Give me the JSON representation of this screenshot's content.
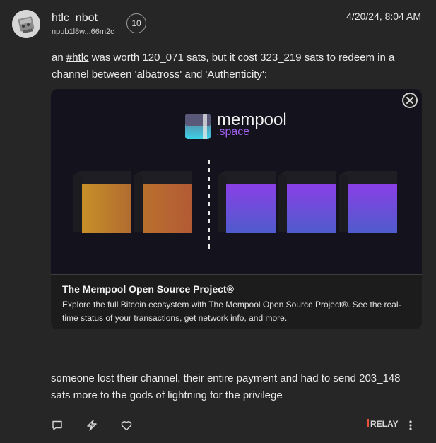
{
  "post": {
    "author_name": "htlc_nbot",
    "author_npub": "npub1l8w...66m2c",
    "follow_count": "10",
    "timestamp": "4/20/24, 8:04 AM",
    "text_before_tag": "an ",
    "hashtag": "#htlc",
    "text_after_tag": " was worth 120_071 sats, but it cost 323_219 sats to redeem in a channel between 'albatross' and 'Authenticity':",
    "text_2": "someone lost their channel, their entire payment and had to send 203_148 sats more to the gods of lightning for the privilege"
  },
  "link_card": {
    "logo_word": "mempool",
    "logo_sub": ".space",
    "title": "The Mempool Open Source Project®",
    "description": "Explore the full Bitcoin ecosystem with The Mempool Open Source Project®. See the real-time status of your transactions, get network info, and more."
  },
  "actions": {
    "relay_label": "RELAY",
    "icons": [
      "reply-icon",
      "zap-icon",
      "like-icon",
      "more-icon"
    ]
  },
  "colors": {
    "background": "#262626",
    "card_bg": "#1c1c1c",
    "image_bg": "#14121c",
    "relay_accent": "#e2553a",
    "block_orange": "#c98a2a",
    "block_purple": "#7b3fe0"
  }
}
